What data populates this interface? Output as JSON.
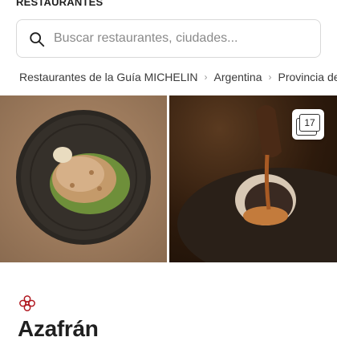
{
  "section_label": "RESTAURANTES",
  "search": {
    "placeholder": "Buscar restaurantes, ciudades..."
  },
  "breadcrumb": [
    {
      "label": "Restaurantes de la Guía MICHELIN"
    },
    {
      "label": "Argentina"
    },
    {
      "label": "Provincia de Mendoza"
    }
  ],
  "gallery": {
    "photo_count": "17",
    "photos": [
      {
        "icon": "plated-dish-photo"
      },
      {
        "icon": "dessert-sauce-photo"
      }
    ]
  },
  "restaurant": {
    "distinction_icon": "michelin-star-icon",
    "name": "Azafrán"
  },
  "colors": {
    "accent": "#b0171f",
    "text": "#1f1f1f",
    "border": "#d9d9d9"
  }
}
